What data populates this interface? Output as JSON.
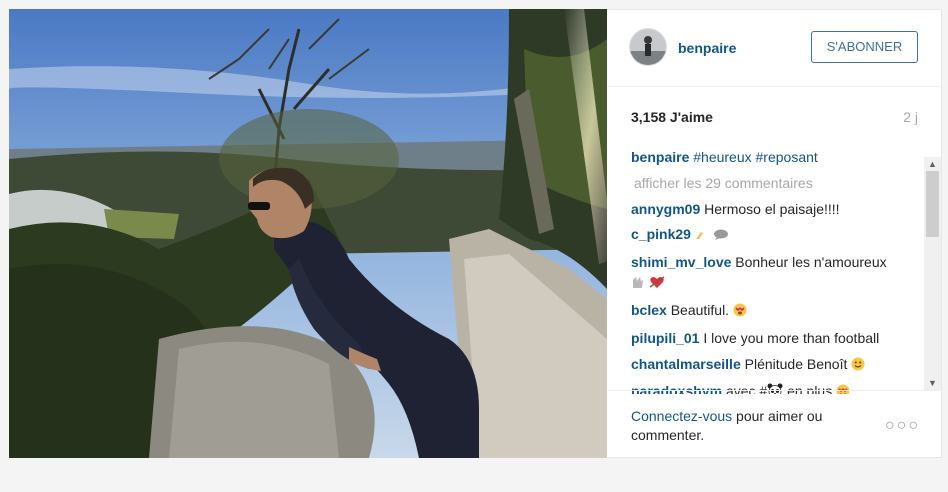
{
  "post": {
    "username": "benpaire",
    "follow_label": "S'ABONNER",
    "likes": "3,158 J'aime",
    "time": "2 j",
    "caption": {
      "user": "benpaire",
      "tags": "#heureux #reposant"
    },
    "view_all": "afficher les 29 commentaires",
    "comments": [
      {
        "user": "annygm09",
        "text": "Hermoso el paisaje!!!!"
      },
      {
        "user": "c_pink29",
        "text": ""
      },
      {
        "user": "shimi_mv_love",
        "text": "Bonheur les n'amoureux"
      },
      {
        "user": "bclex",
        "text": "Beautiful."
      },
      {
        "user": "pilupili_01",
        "text": "I love you more than football"
      },
      {
        "user": "chantalmarseille",
        "text": "Plénitude Benoît"
      },
      {
        "user": "paradoxshym",
        "text_before": "avec #",
        "text_after": " en plus"
      }
    ],
    "footer": {
      "login_link": "Connectez-vous",
      "login_rest": " pour aimer ou commenter."
    },
    "more_options": "○○○"
  }
}
